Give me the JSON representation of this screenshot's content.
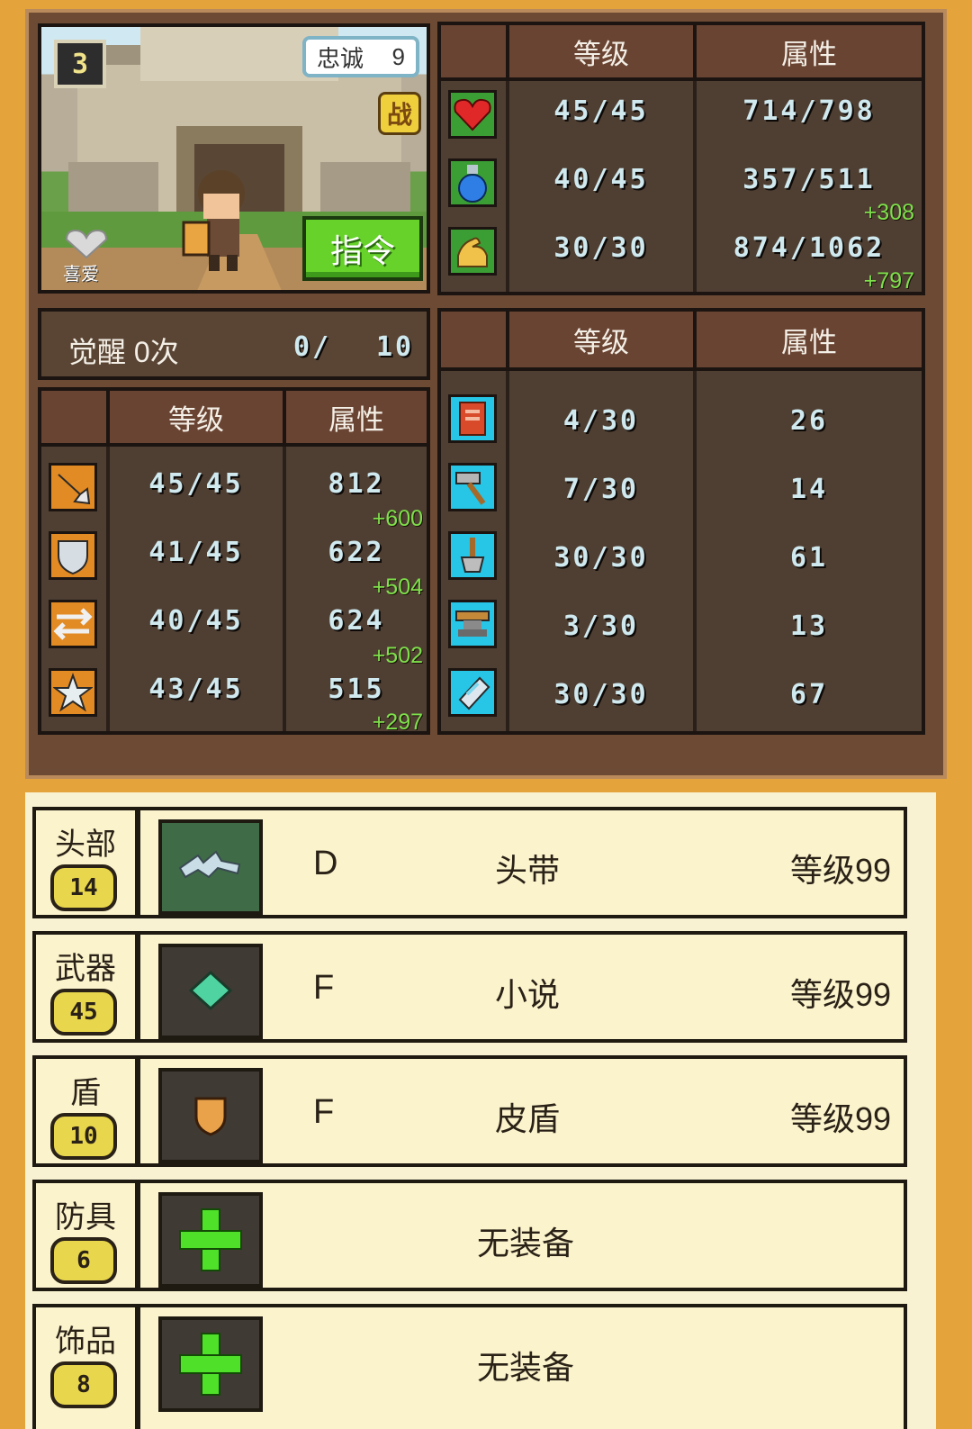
{
  "character": {
    "level_badge": "3",
    "loyalty_label": "忠诚",
    "loyalty_value": "9",
    "battle_badge": "战",
    "favorite_label": "喜爱",
    "command_button": "指令"
  },
  "awakening": {
    "label": "觉醒 0次",
    "progress": "0/",
    "max": "10"
  },
  "headers": {
    "level": "等级",
    "attribute": "属性"
  },
  "top_stats": [
    {
      "icon": "heart-icon",
      "level": "45/45",
      "attr": "714/798",
      "bonus": ""
    },
    {
      "icon": "potion-icon",
      "level": "40/45",
      "attr": "357/511",
      "bonus": "+308"
    },
    {
      "icon": "muscle-icon",
      "level": "30/30",
      "attr": "874/1062",
      "bonus": "+797"
    }
  ],
  "combat_stats": [
    {
      "icon": "sword-icon",
      "level": "45/45",
      "attr": "812",
      "bonus": "+600"
    },
    {
      "icon": "shield-icon",
      "level": "41/45",
      "attr": "622",
      "bonus": "+504"
    },
    {
      "icon": "arrows-icon",
      "level": "40/45",
      "attr": "624",
      "bonus": "+502"
    },
    {
      "icon": "star-icon",
      "level": "43/45",
      "attr": "515",
      "bonus": "+297"
    }
  ],
  "craft_stats": [
    {
      "icon": "book-icon",
      "level": "4/30",
      "attr": "26"
    },
    {
      "icon": "hammer-icon",
      "level": "7/30",
      "attr": "14"
    },
    {
      "icon": "shovel-icon",
      "level": "30/30",
      "attr": "61"
    },
    {
      "icon": "anvil-icon",
      "level": "3/30",
      "attr": "13"
    },
    {
      "icon": "gem-icon",
      "level": "30/30",
      "attr": "67"
    }
  ],
  "equipment": [
    {
      "slot": "头部",
      "badge": "14",
      "rank": "D",
      "name": "头带",
      "level": "等级99",
      "icon": "headband-icon"
    },
    {
      "slot": "武器",
      "badge": "45",
      "rank": "F",
      "name": "小说",
      "level": "等级99",
      "icon": "book-item-icon"
    },
    {
      "slot": "盾",
      "badge": "10",
      "rank": "F",
      "name": "皮盾",
      "level": "等级99",
      "icon": "leather-shield-icon"
    },
    {
      "slot": "防具",
      "badge": "6",
      "empty": "无装备",
      "icon": "add-icon"
    },
    {
      "slot": "饰品",
      "badge": "8",
      "empty": "无装备",
      "icon": "add-icon"
    }
  ],
  "colors": {
    "bonus_green": "#7ee04b",
    "value_cyan": "#cfe9ef",
    "board_brown": "#6d4a33",
    "panel_dark": "#4f3f33"
  }
}
